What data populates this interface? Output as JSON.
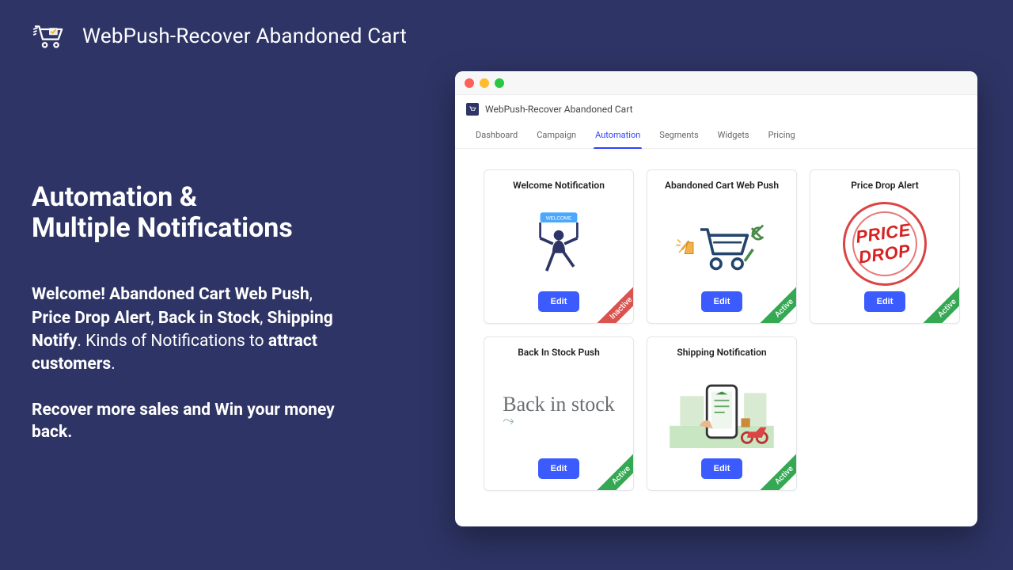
{
  "header": {
    "title": "WebPush-Recover Abandoned Cart"
  },
  "marketing": {
    "heading_l1": "Automation &",
    "heading_l2": "Multiple Notifications",
    "para_lead": "Welcome! Abandoned Cart Web Push",
    "para_mid1": ", ",
    "para_b2": "Price Drop Alert",
    "para_mid2": ", ",
    "para_b3": "Back in Stock",
    "para_mid3": ", ",
    "para_b4": "Shipping Notify",
    "para_tail1": ". Kinds of Notifications to ",
    "para_b5": "attract customers",
    "para_tail2": ".",
    "tagline": "Recover more sales and Win your money back."
  },
  "window": {
    "app_title": "WebPush-Recover Abandoned Cart",
    "tabs": [
      "Dashboard",
      "Campaign",
      "Automation",
      "Segments",
      "Widgets",
      "Pricing"
    ],
    "active_tab_index": 2,
    "edit_label": "Edit",
    "status_active": "Active",
    "status_inactive": "Inactive",
    "cards": [
      {
        "title": "Welcome Notification",
        "status": "inactive"
      },
      {
        "title": "Abandoned Cart Web Push",
        "status": "active"
      },
      {
        "title": "Price Drop Alert",
        "status": "active"
      },
      {
        "title": "Back In Stock Push",
        "status": "active"
      },
      {
        "title": "Shipping Notification",
        "status": "active"
      }
    ]
  }
}
